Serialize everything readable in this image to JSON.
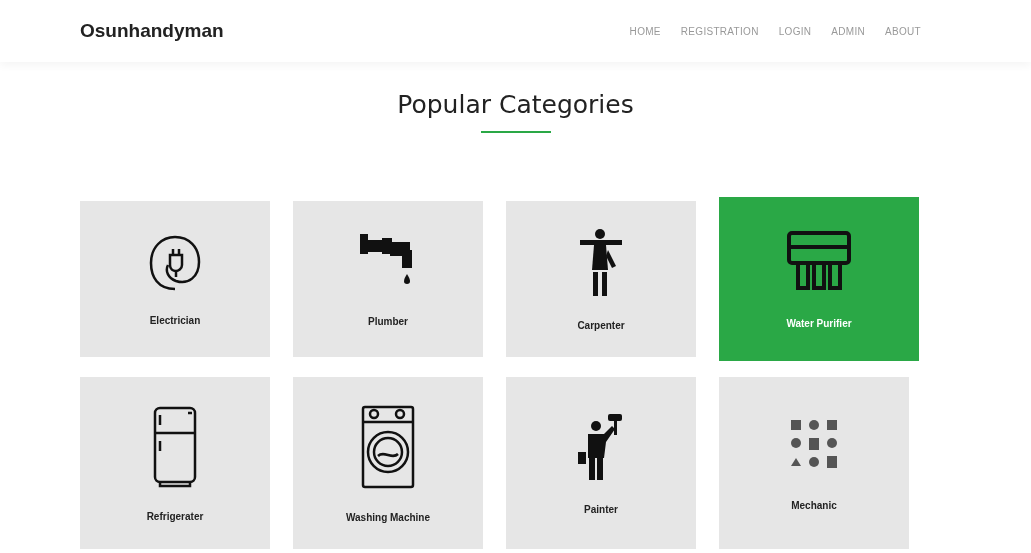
{
  "brand": "Osunhandyman",
  "nav": [
    "HOME",
    "REGISTRATION",
    "LOGIN",
    "ADMIN",
    "ABOUT"
  ],
  "heading": "Popular Categories",
  "categories": [
    {
      "label": "Electrician",
      "kind": "plug",
      "selected": false
    },
    {
      "label": "Plumber",
      "kind": "faucet",
      "selected": false
    },
    {
      "label": "Carpenter",
      "kind": "carpenter",
      "selected": false
    },
    {
      "label": "Water Purifier",
      "kind": "filter",
      "selected": true
    },
    {
      "label": "Refrigerater",
      "kind": "fridge",
      "selected": false
    },
    {
      "label": "Washing Machine",
      "kind": "washer",
      "selected": false
    },
    {
      "label": "Painter",
      "kind": "painter",
      "selected": false
    },
    {
      "label": "Mechanic",
      "kind": "tools",
      "selected": false
    }
  ]
}
